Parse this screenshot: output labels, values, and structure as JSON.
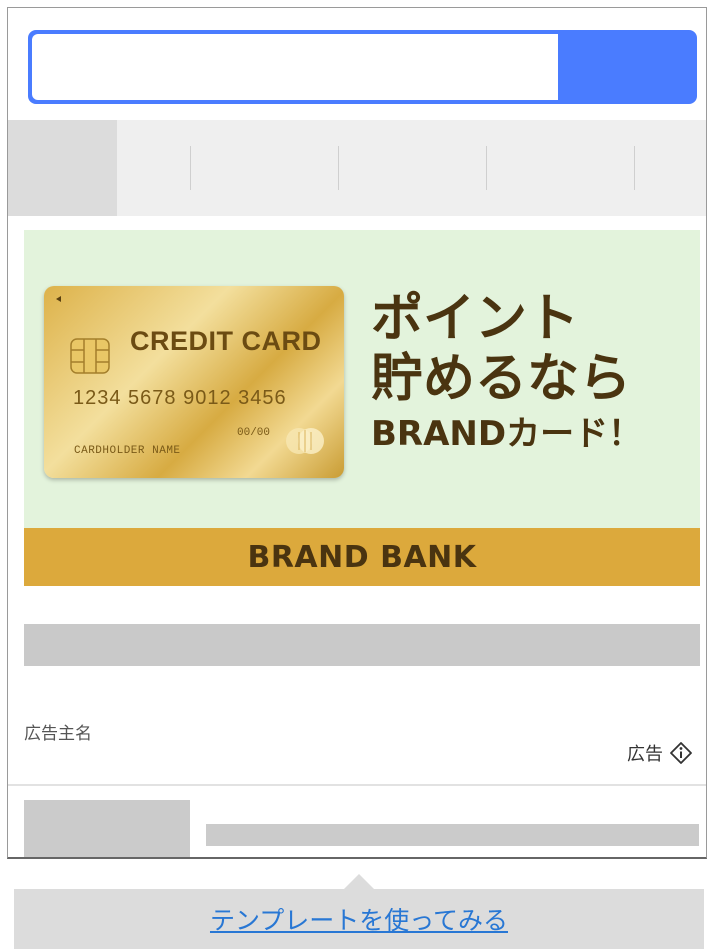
{
  "search": {
    "placeholder": "",
    "value": "",
    "button_label": ""
  },
  "tabs": [
    {
      "label": "",
      "active": true
    },
    {
      "label": ""
    },
    {
      "label": ""
    },
    {
      "label": ""
    },
    {
      "label": ""
    }
  ],
  "ad": {
    "card": {
      "title": "CREDIT CARD",
      "number": "1234 5678 9012 3456",
      "expiry": "00/00",
      "holder": "CARDHOLDER NAME"
    },
    "headline_line1": "ポイント",
    "headline_line2": "貯めるなら",
    "headline_line3": "BRANDカード！",
    "bank_name": "BRAND BANK",
    "colors": {
      "background": "#e3f3dc",
      "bank_bar": "#dca93c",
      "text": "#4a3410"
    }
  },
  "listing": {
    "sponsor": "広告主名",
    "ad_label": "広告",
    "info_icon": "info-icon"
  },
  "tooltip": {
    "link": "テンプレートを使ってみる"
  },
  "colors": {
    "accent": "#4a7cff",
    "link": "#2877d4"
  }
}
